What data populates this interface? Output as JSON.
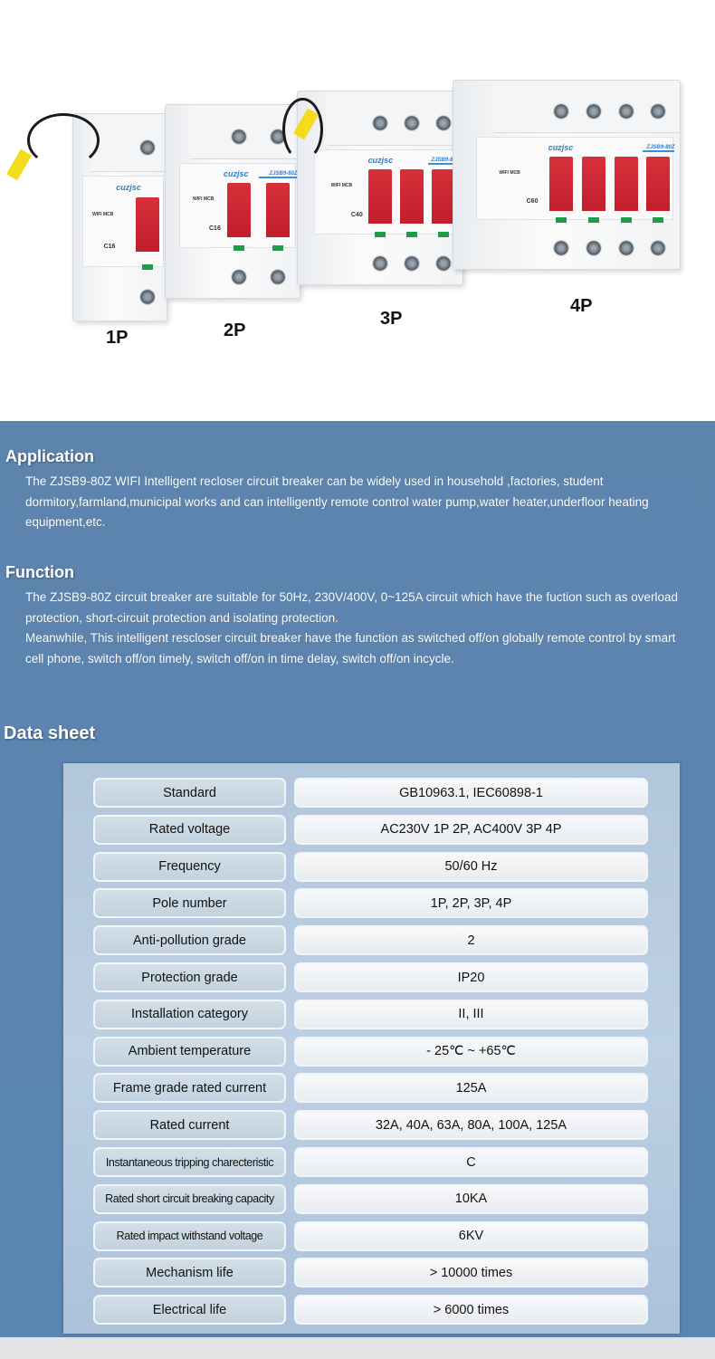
{
  "products": [
    {
      "label": "1P",
      "poles": 1,
      "brand": "cuzjsc",
      "rating": "C16"
    },
    {
      "label": "2P",
      "poles": 2,
      "brand": "cuzjsc",
      "model": "ZJSB9-80Z",
      "rating": "C16"
    },
    {
      "label": "3P",
      "poles": 3,
      "brand": "cuzjsc",
      "model": "ZJSB9-80Z",
      "rating": "C40"
    },
    {
      "label": "4P",
      "poles": 4,
      "brand": "cuzjsc",
      "model": "ZJSB9-80Z",
      "rating": "C60"
    }
  ],
  "device_marking": "WIFI MCB",
  "application": {
    "heading": "Application",
    "text": "The ZJSB9-80Z WIFI Intelligent recloser circuit breaker can be widely used in household ,factories, student dormitory,farmland,municipal works and can intelligently remote control water pump,water heater,underfloor heating equipment,etc."
  },
  "function": {
    "heading": "Function",
    "text1": "The ZJSB9-80Z circuit breaker are suitable for 50Hz, 230V/400V, 0~125A circuit which have the fuction such as overload protection, short-circuit protection and isolating protection.",
    "text2": "Meanwhile, This intelligent rescloser circuit breaker have the function as switched off/on globally remote control by smart cell phone, switch off/on timely, switch off/on in time delay, switch off/on incycle."
  },
  "datasheet": {
    "heading": "Data sheet",
    "rows": [
      {
        "label": "Standard",
        "value": "GB10963.1, IEC60898-1"
      },
      {
        "label": "Rated voltage",
        "value": "AC230V 1P 2P, AC400V 3P 4P"
      },
      {
        "label": "Frequency",
        "value": "50/60 Hz"
      },
      {
        "label": "Pole number",
        "value": "1P, 2P, 3P, 4P"
      },
      {
        "label": "Anti-pollution grade",
        "value": "2"
      },
      {
        "label": "Protection grade",
        "value": "IP20"
      },
      {
        "label": "Installation category",
        "value": "II, III"
      },
      {
        "label": "Ambient temperature",
        "value": "- 25℃ ~ +65℃"
      },
      {
        "label": "Frame grade rated current",
        "value": "125A"
      },
      {
        "label": "Rated current",
        "value": "32A, 40A, 63A, 80A, 100A, 125A"
      },
      {
        "label": "Instantaneous tripping charecteristic",
        "value": "C",
        "small": true
      },
      {
        "label": "Rated short circuit breaking capacity",
        "value": "10KA",
        "small": true
      },
      {
        "label": "Rated impact withstand voltage",
        "value": "6KV",
        "small": true
      },
      {
        "label": "Mechanism life",
        "value": "> 10000 times"
      },
      {
        "label": "Electrical life",
        "value": "> 6000 times"
      }
    ]
  },
  "colors": {
    "section_bg": "#5b84b0",
    "toggle": "#c92230",
    "brand_blue": "#2a7fd0",
    "led": "#1e9d48"
  }
}
